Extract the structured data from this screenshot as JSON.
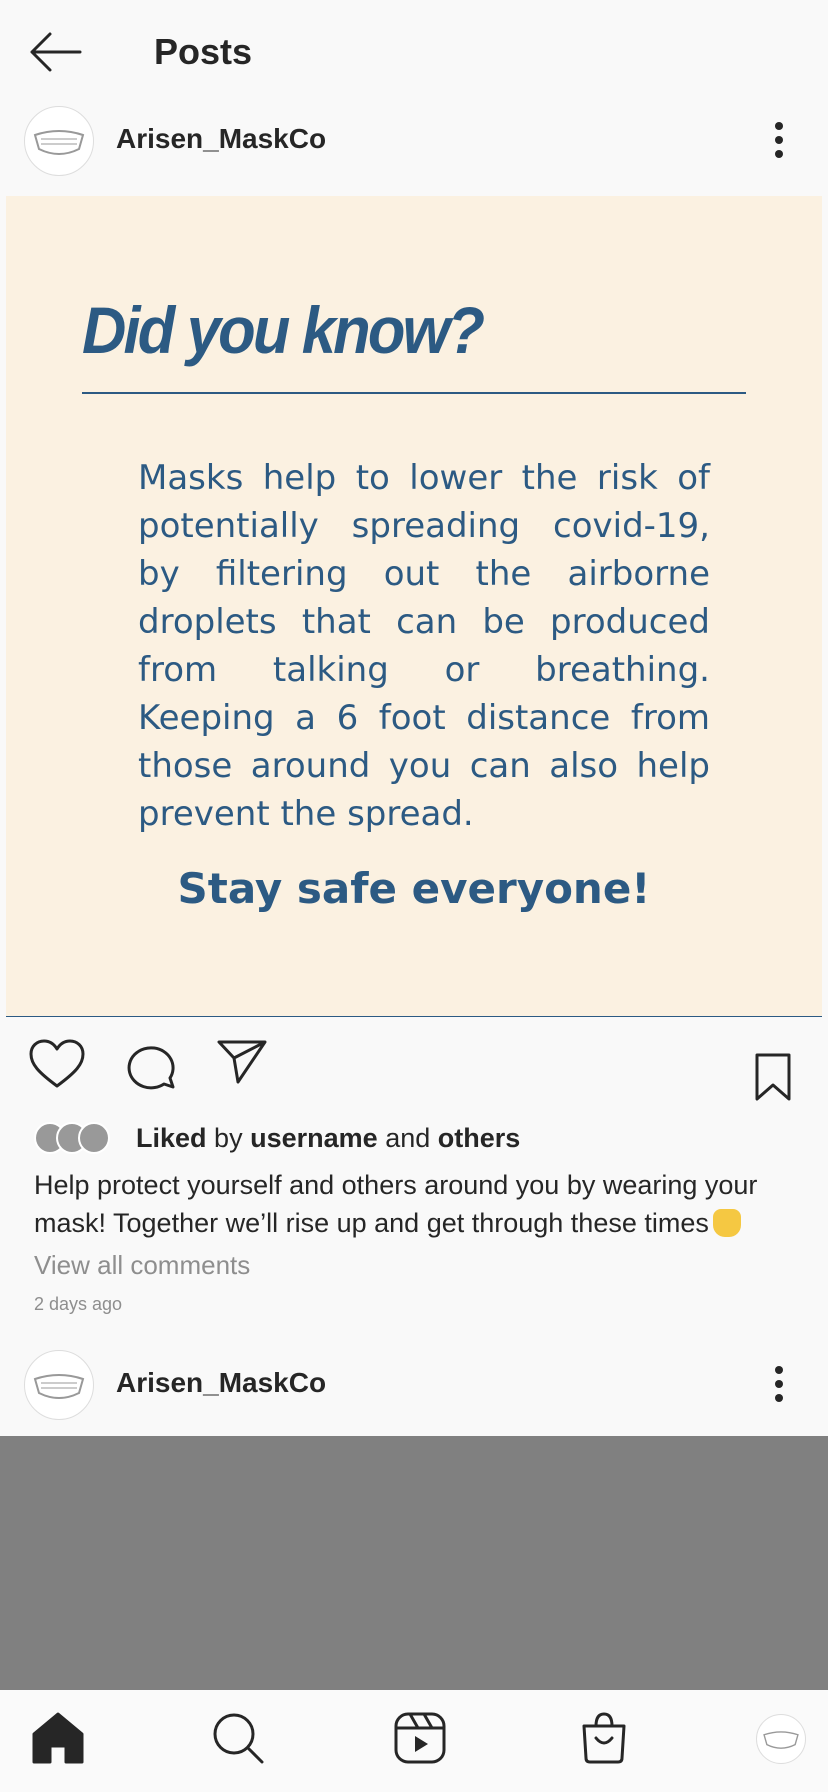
{
  "header": {
    "title": "Posts"
  },
  "post": {
    "username": "Arisen_MaskCo",
    "image": {
      "headline": "Did you know?",
      "body": "Masks help to lower the risk of potentially spreading covid-19, by filtering out the airborne droplets that can be produced from talking or breathing. Keeping a 6 foot distance from those around you can also help prevent the spread.",
      "closing": "Stay safe everyone!"
    },
    "likes": {
      "prefix": "Liked",
      "by": "by",
      "user": "username",
      "and": "and",
      "others": "others"
    },
    "caption": "Help protect yourself and others around you by wearing your mask! Together we’ll rise up and get through these times",
    "view_comments": "View all comments",
    "timestamp": "2 days ago"
  },
  "next_post": {
    "username": "Arisen_MaskCo"
  },
  "nav": {
    "items": [
      {
        "icon": "home-icon"
      },
      {
        "icon": "search-icon"
      },
      {
        "icon": "reels-icon"
      },
      {
        "icon": "shop-icon"
      },
      {
        "icon": "profile-avatar"
      }
    ]
  },
  "colors": {
    "image_bg": "#fbf1e1",
    "image_text": "#2c5a83",
    "next_image_bg": "#808080"
  }
}
